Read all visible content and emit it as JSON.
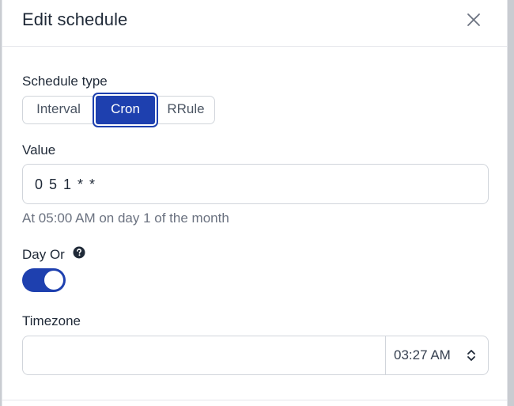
{
  "dialog": {
    "title": "Edit schedule",
    "close_icon": "close-icon"
  },
  "schedule_type": {
    "label": "Schedule type",
    "options": [
      "Interval",
      "Cron",
      "RRule"
    ],
    "selected": "Cron"
  },
  "value_field": {
    "label": "Value",
    "value": "0 5 1 * *",
    "description": "At 05:00 AM on day 1 of the month"
  },
  "day_or": {
    "label": "Day Or",
    "help_icon": "question-circle-icon",
    "enabled": true
  },
  "timezone": {
    "label": "Timezone",
    "value": "",
    "time": "03:27 AM",
    "chevron_icon": "chevron-up-down-icon"
  },
  "colors": {
    "accent": "#1e40af",
    "text": "#1f2937",
    "muted": "#6b7280",
    "border": "#d1d5db"
  }
}
